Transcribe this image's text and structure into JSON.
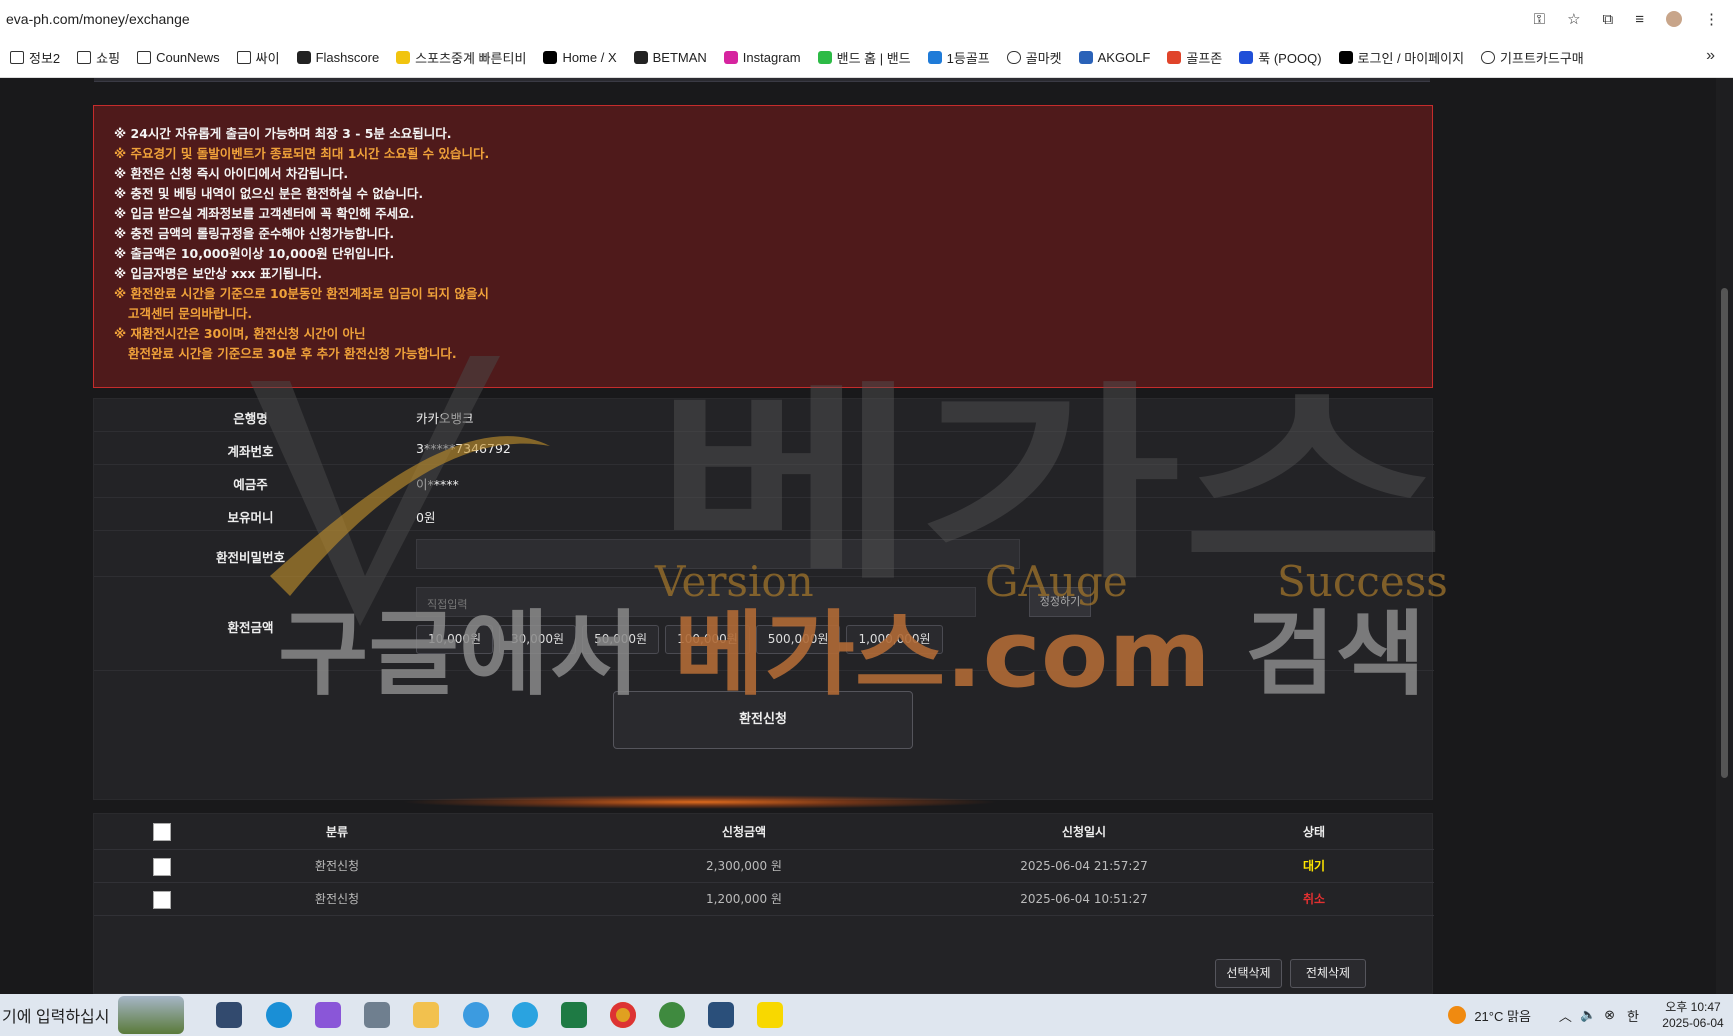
{
  "browser": {
    "url": "eva-ph.com/money/exchange",
    "bookmarks": [
      {
        "label": "정보2",
        "icon": "folder-icon"
      },
      {
        "label": "쇼핑",
        "icon": "folder-icon"
      },
      {
        "label": "CounNews",
        "icon": "folder-icon"
      },
      {
        "label": "싸이",
        "icon": "folder-icon"
      },
      {
        "label": "Flashscore",
        "icon": "flashscore-icon"
      },
      {
        "label": "스포츠중계 빠른티비",
        "icon": "tv-icon"
      },
      {
        "label": "Home / X",
        "icon": "x-icon"
      },
      {
        "label": "BETMAN",
        "icon": "betman-icon"
      },
      {
        "label": "Instagram",
        "icon": "instagram-icon"
      },
      {
        "label": "밴드 홈 | 밴드",
        "icon": "band-icon"
      },
      {
        "label": "1등골프",
        "icon": "golf-icon"
      },
      {
        "label": "골마켓",
        "icon": "globe-icon"
      },
      {
        "label": "AKGOLF",
        "icon": "akgolf-icon"
      },
      {
        "label": "골프존",
        "icon": "golfzon-icon"
      },
      {
        "label": "푹 (POOQ)",
        "icon": "pooq-icon"
      },
      {
        "label": "로그인 / 마이페이지",
        "icon": "w-icon"
      },
      {
        "label": "기프트카드구매",
        "icon": "globe-icon"
      }
    ],
    "more": "»"
  },
  "notice": {
    "lines": [
      {
        "text": "※ 24시간 자유롭게 출금이 가능하며 최장 3 - 5분 소요됩니다.",
        "color": "white"
      },
      {
        "text": "※ 주요경기 및 돌발이벤트가 종료되면 최대 1시간 소요될 수 있습니다.",
        "color": "orange"
      },
      {
        "text": "※ 환전은 신청 즉시 아이디에서 차감됩니다.",
        "color": "white"
      },
      {
        "text": "※ 충전 및 베팅 내역이 없으신 분은 환전하실 수 없습니다.",
        "color": "white"
      },
      {
        "text": "※ 입금 받으실 계좌정보를 고객센터에 꼭 확인해 주세요.",
        "color": "white"
      },
      {
        "text": "※ 충전 금액의 롤링규정을 준수해야 신청가능합니다.",
        "color": "white"
      },
      {
        "text": "※ 출금액은 10,000원이상 10,000원 단위입니다.",
        "color": "white"
      },
      {
        "text": "※ 입금자명은 보안상 xxx 표기됩니다.",
        "color": "white"
      },
      {
        "text": "※ 환전완료 시간을 기준으로 10분동안 환전계좌로 입금이 되지 않을시",
        "color": "orange"
      },
      {
        "text": "고객센터 문의바랍니다.",
        "color": "orange",
        "indent": true
      },
      {
        "text": "※ 재환전시간은 30이며, 환전신청 시간이 아닌",
        "color": "orange"
      },
      {
        "text": "환전완료 시간을 기준으로 30분 후 추가 환전신청 가능합니다.",
        "color": "orange",
        "indent": true
      }
    ]
  },
  "form": {
    "bank_label": "은행명",
    "bank_value": "카카오뱅크",
    "account_label": "계좌번호",
    "account_value": "3*****7346792",
    "holder_label": "예금주",
    "holder_value": "이*****",
    "money_label": "보유머니",
    "money_value": "0원",
    "password_label": "환전비밀번호",
    "amount_label": "환전금액",
    "amount_placeholder": "직접입력",
    "reset_label": "정정하기",
    "quick_amounts": [
      "10,000원",
      "30,000원",
      "50,000원",
      "100,000원",
      "500,000원",
      "1,000,000원"
    ],
    "submit_label": "환전신청"
  },
  "history": {
    "headers": [
      "분류",
      "신청금액",
      "신청일시",
      "상태"
    ],
    "rows": [
      {
        "type": "환전신청",
        "amount": "2,300,000 원",
        "datetime": "2025-06-04 21:57:27",
        "status": "대기",
        "status_color": "#ffe600"
      },
      {
        "type": "환전신청",
        "amount": "1,200,000 원",
        "datetime": "2025-06-04 10:51:27",
        "status": "취소",
        "status_color": "#e23030"
      }
    ],
    "delete_selected": "선택삭제",
    "delete_all": "전체삭제"
  },
  "watermark": {
    "brand": "베가스",
    "tagline": [
      "Version",
      "GAuge",
      "Success"
    ],
    "search_prefix": "구글에서 ",
    "search_brand": "베가스.com",
    "search_suffix": " 검색"
  },
  "taskbar": {
    "search_text": "기에 입력하십시",
    "weather": "21°C 맑음",
    "ime": "한",
    "time": "오후 10:47",
    "date": "2025-06-04"
  }
}
